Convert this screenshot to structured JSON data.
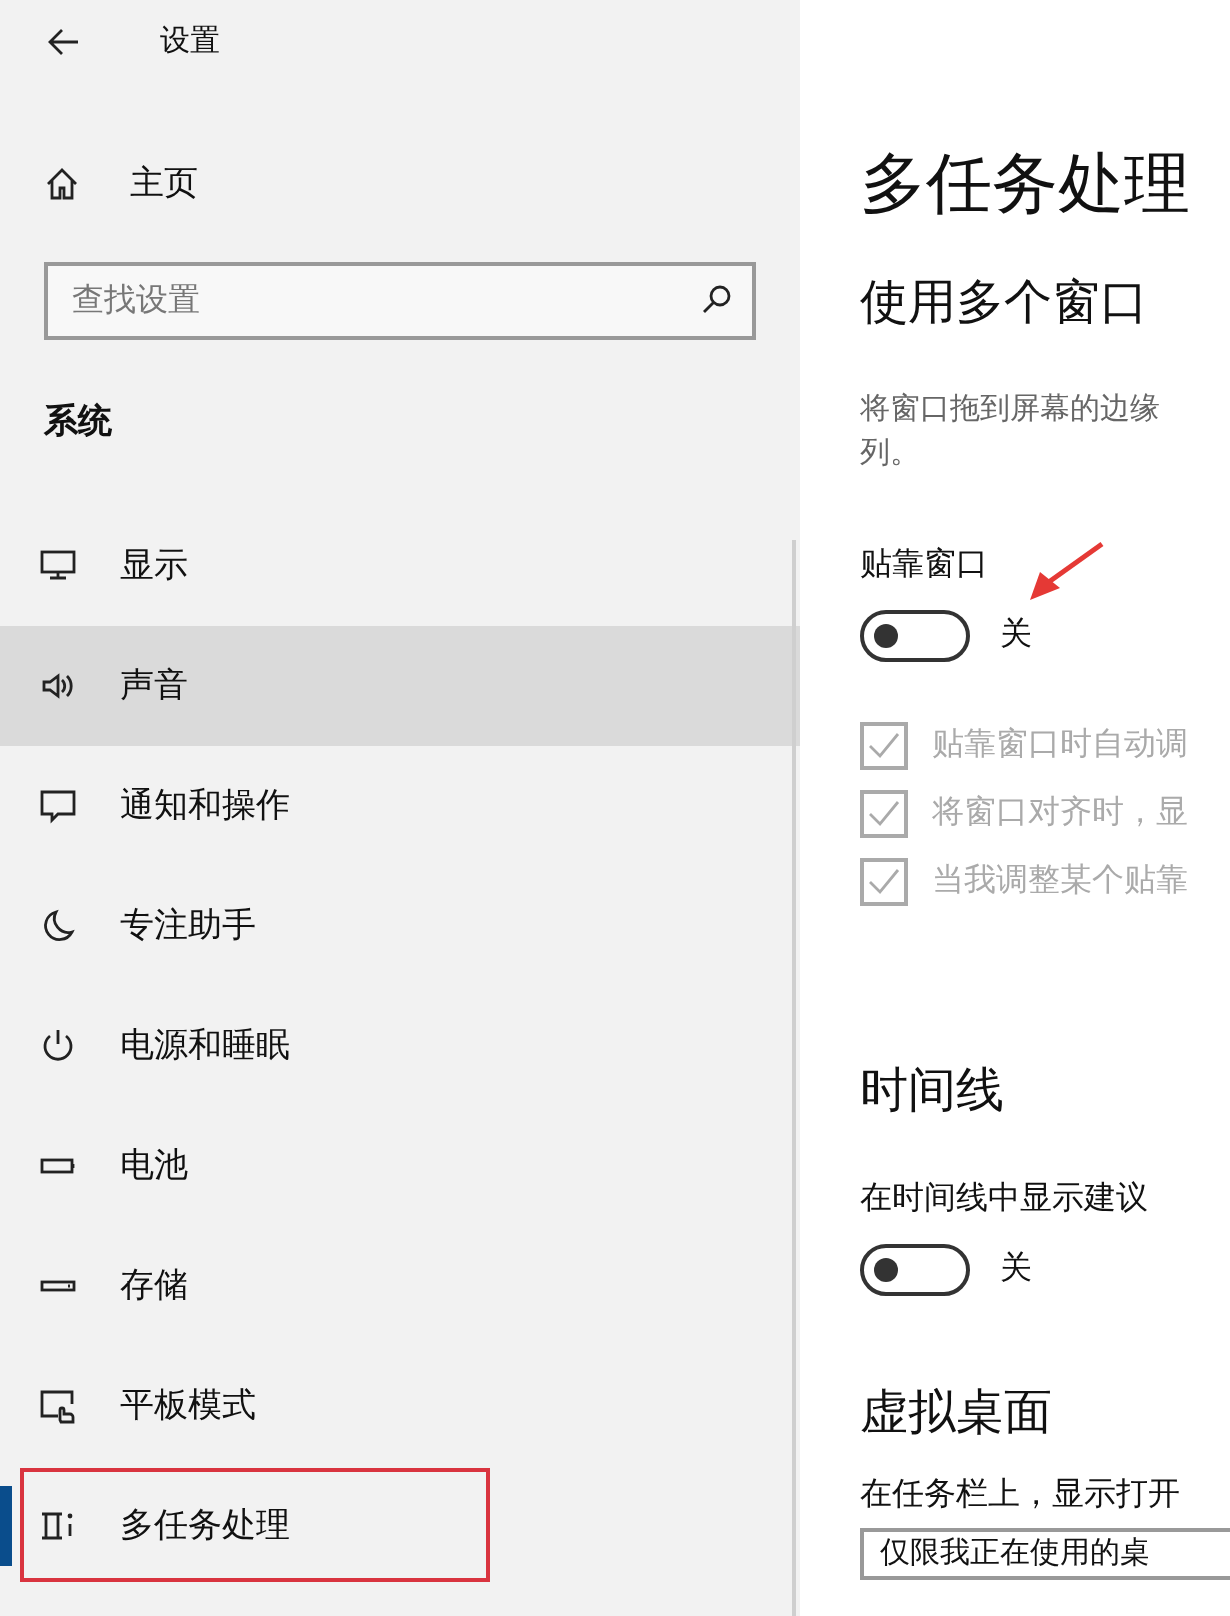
{
  "sidebar": {
    "title": "设置",
    "home": "主页",
    "search": {
      "placeholder": "查找设置"
    },
    "section": "系统",
    "items": [
      {
        "label": "显示",
        "kind": "display",
        "selected": false,
        "hovered": false
      },
      {
        "label": "声音",
        "kind": "sound",
        "selected": false,
        "hovered": true
      },
      {
        "label": "通知和操作",
        "kind": "notify",
        "selected": false,
        "hovered": false
      },
      {
        "label": "专注助手",
        "kind": "moon",
        "selected": false,
        "hovered": false
      },
      {
        "label": "电源和睡眠",
        "kind": "power",
        "selected": false,
        "hovered": false
      },
      {
        "label": "电池",
        "kind": "battery",
        "selected": false,
        "hovered": false
      },
      {
        "label": "存储",
        "kind": "storage",
        "selected": false,
        "hovered": false
      },
      {
        "label": "平板模式",
        "kind": "tablet",
        "selected": false,
        "hovered": false
      },
      {
        "label": "多任务处理",
        "kind": "multitask",
        "selected": true,
        "hovered": false
      }
    ]
  },
  "content": {
    "title": "多任务处理",
    "sections": [
      {
        "heading": "使用多个窗口",
        "description": [
          "将窗口拖到屏幕的边缘",
          "列。"
        ],
        "toggle": {
          "label": "贴靠窗口",
          "on": false,
          "state_text": "关"
        },
        "checkboxes": [
          {
            "label": "贴靠窗口时自动调",
            "checked": true,
            "disabled": true
          },
          {
            "label": "将窗口对齐时，显",
            "checked": true,
            "disabled": true
          },
          {
            "label": "当我调整某个贴靠",
            "checked": true,
            "disabled": true
          }
        ]
      },
      {
        "heading": "时间线",
        "toggle": {
          "label": "在时间线中显示建议",
          "on": false,
          "state_text": "关"
        }
      },
      {
        "heading": "虚拟桌面",
        "text": "在任务栏上，显示打开",
        "dropdown": {
          "value": "仅限我正在使用的桌"
        }
      }
    ]
  }
}
